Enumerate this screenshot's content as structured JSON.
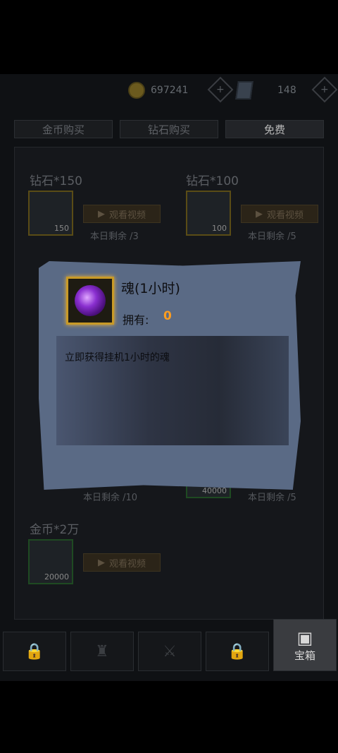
{
  "currency": {
    "coins": "697241",
    "gems": "148"
  },
  "tabs": [
    {
      "label": "金币购买"
    },
    {
      "label": "钻石购买"
    },
    {
      "label": "免费"
    }
  ],
  "cards": [
    {
      "title": "钻石*150",
      "qty": "150",
      "button": "观看视频",
      "remaining": "本日剩余 /3"
    },
    {
      "title": "钻石*100",
      "qty": "100",
      "button": "观看视频",
      "remaining": "本日剩余 /5"
    },
    {
      "remaining": "本日剩余 /10",
      "qty": "40000",
      "remaining2": "本日剩余 /5"
    },
    {
      "title": "金币*2万",
      "qty": "20000",
      "button": "观看视频"
    }
  ],
  "nav": {
    "chest_label": "宝箱"
  },
  "popup": {
    "title": "魂(1小时)",
    "owned_label": "拥有:",
    "owned_value": "0",
    "description": "立即获得挂机1小时的魂"
  },
  "colors": {
    "accent_orange": "#ff9d1e",
    "frame_gold": "#c89a27",
    "popup_bg": "#5a6a85"
  }
}
